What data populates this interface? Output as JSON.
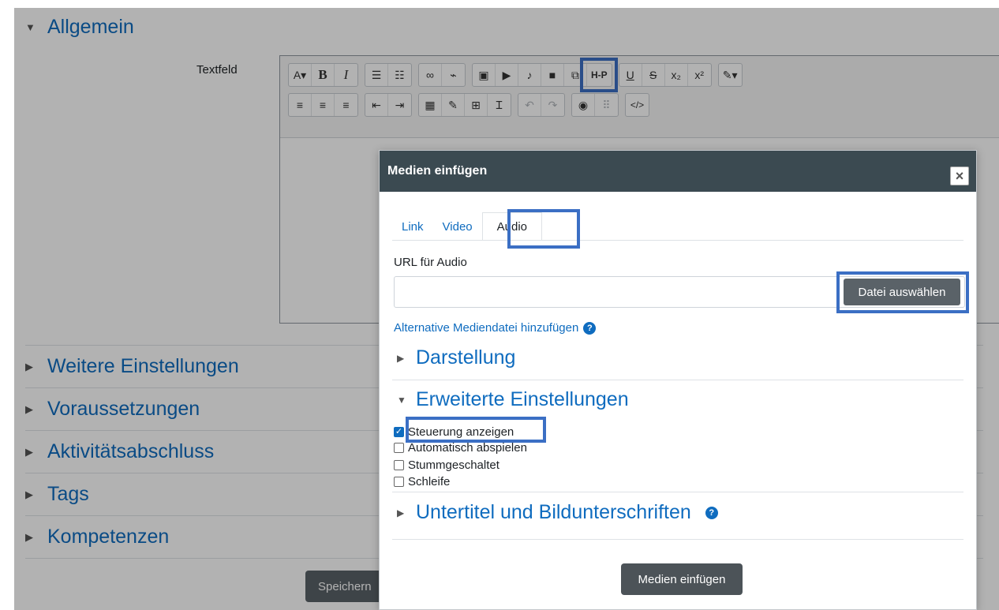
{
  "sections": {
    "allgemein": "Allgemein",
    "weitere": "Weitere Einstellungen",
    "voraussetzungen": "Voraussetzungen",
    "aktivitaet": "Aktivitätsabschluss",
    "tags": "Tags",
    "kompetenzen": "Kompetenzen"
  },
  "form": {
    "textfield_label": "Textfeld",
    "save_button": "Speichern"
  },
  "toolbar": {
    "row1": [
      {
        "name": "font-size",
        "glyph": "A▾"
      },
      {
        "name": "bold",
        "glyph": "B"
      },
      {
        "name": "italic",
        "glyph": "I"
      },
      {
        "name": "unordered-list",
        "glyph": "☰"
      },
      {
        "name": "ordered-list",
        "glyph": "☷"
      },
      {
        "name": "link",
        "glyph": "🔗"
      },
      {
        "name": "unlink",
        "glyph": "⛓"
      },
      {
        "name": "image",
        "glyph": "▣"
      },
      {
        "name": "media",
        "glyph": "▶"
      },
      {
        "name": "record-audio",
        "glyph": "🎙"
      },
      {
        "name": "record-video",
        "glyph": "■"
      },
      {
        "name": "manage-files",
        "glyph": "⧉"
      },
      {
        "name": "h5p",
        "glyph": "H-P"
      },
      {
        "name": "underline",
        "glyph": "U"
      },
      {
        "name": "strikethrough",
        "glyph": "S"
      },
      {
        "name": "subscript",
        "glyph": "x₂"
      },
      {
        "name": "superscript",
        "glyph": "x²"
      },
      {
        "name": "text-color",
        "glyph": "🖌▾"
      }
    ],
    "row2": [
      {
        "name": "align-left",
        "glyph": "≡"
      },
      {
        "name": "align-center",
        "glyph": "≡"
      },
      {
        "name": "align-right",
        "glyph": "≡"
      },
      {
        "name": "outdent",
        "glyph": "⇤"
      },
      {
        "name": "indent",
        "glyph": "⇥"
      },
      {
        "name": "equation",
        "glyph": "▦"
      },
      {
        "name": "special-char",
        "glyph": "✎"
      },
      {
        "name": "table",
        "glyph": "⊞"
      },
      {
        "name": "clear-format",
        "glyph": "Ɪ"
      },
      {
        "name": "undo",
        "glyph": "↶"
      },
      {
        "name": "redo",
        "glyph": "↷"
      },
      {
        "name": "accessibility",
        "glyph": "◉"
      },
      {
        "name": "screenreader",
        "glyph": "⠿"
      },
      {
        "name": "html",
        "glyph": "</>"
      }
    ]
  },
  "modal": {
    "title": "Medien einfügen",
    "close": "×",
    "tabs": [
      "Link",
      "Video",
      "Audio"
    ],
    "url_label": "URL für Audio",
    "url_value": "",
    "file_button": "Datei auswählen",
    "alt_link": "Alternative Mediendatei hinzufügen",
    "help": "?",
    "sec_darstellung": "Darstellung",
    "sec_erweitert": "Erweiterte Einstellungen",
    "checkboxes": [
      {
        "label": "Steuerung anzeigen",
        "checked": true
      },
      {
        "label": "Automatisch abspielen",
        "checked": false
      },
      {
        "label": "Stummgeschaltet",
        "checked": false
      },
      {
        "label": "Schleife",
        "checked": false
      }
    ],
    "sec_untertitel": "Untertitel und Bildunterschriften",
    "insert_button": "Medien einfügen"
  },
  "colors": {
    "accent": "#0f6cbf",
    "highlight": "#3b6fc4",
    "header": "#3b4a51"
  }
}
